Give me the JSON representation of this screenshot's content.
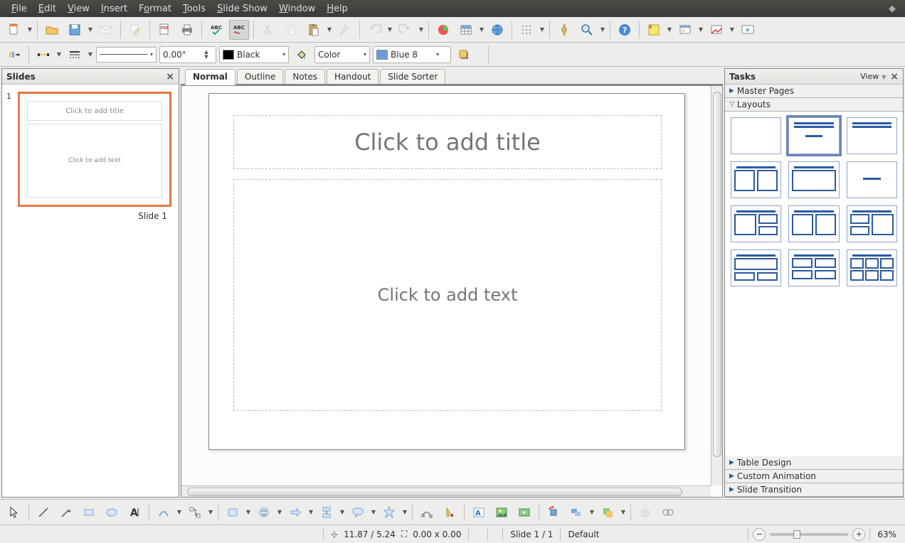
{
  "menu": {
    "items": [
      "File",
      "Edit",
      "View",
      "Insert",
      "Format",
      "Tools",
      "Slide Show",
      "Window",
      "Help"
    ]
  },
  "toolbar2": {
    "line_width": "0.00\"",
    "line_color": "Black",
    "fill_type": "Color",
    "fill_color": "Blue 8"
  },
  "slides_panel": {
    "title": "Slides",
    "slide_number": "1",
    "thumb_title": "Click to add title",
    "thumb_text": "Click to add text",
    "slide_label": "Slide 1"
  },
  "view_tabs": [
    "Normal",
    "Outline",
    "Notes",
    "Handout",
    "Slide Sorter"
  ],
  "active_view_tab": 0,
  "slide": {
    "title_placeholder": "Click to add title",
    "text_placeholder": "Click to add text"
  },
  "tasks_panel": {
    "title": "Tasks",
    "view_label": "View",
    "sections": [
      "Master Pages",
      "Layouts",
      "Table Design",
      "Custom Animation",
      "Slide Transition"
    ],
    "expanded": 1,
    "selected_layout": 1
  },
  "statusbar": {
    "coords": "11.87 / 5.24",
    "size": "0.00 x 0.00",
    "slide_info": "Slide 1 / 1",
    "page_style": "Default",
    "zoom": "63%"
  }
}
